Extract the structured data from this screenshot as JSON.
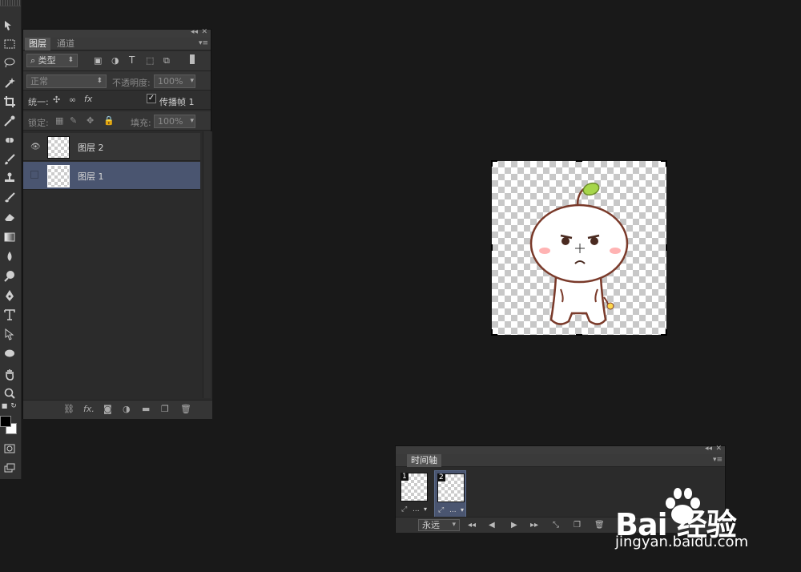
{
  "layers_panel": {
    "tabs": [
      "图层",
      "通道"
    ],
    "filter_kind": "类型",
    "blend_mode": "正常",
    "opacity_label": "不透明度:",
    "opacity_value": "100%",
    "unify_label": "统一:",
    "propagate_label": "传播帧 1",
    "lock_label": "锁定:",
    "fill_label": "填充:",
    "fill_value": "100%",
    "layers": [
      {
        "name": "图层 2",
        "visible": true,
        "selected": false
      },
      {
        "name": "图层 1",
        "visible": false,
        "selected": true
      }
    ]
  },
  "timeline": {
    "tab": "时间轴",
    "frames": [
      {
        "number": "1",
        "delay": "..."
      },
      {
        "number": "2",
        "delay": "..."
      }
    ],
    "loop": "永远"
  },
  "watermark": {
    "brand": "Bai 经验",
    "url": "jingyan.baidu.com"
  },
  "colors": {
    "accent_selected": "#4a5570",
    "panel_bg": "#2b2b2b",
    "background": "#191919"
  }
}
